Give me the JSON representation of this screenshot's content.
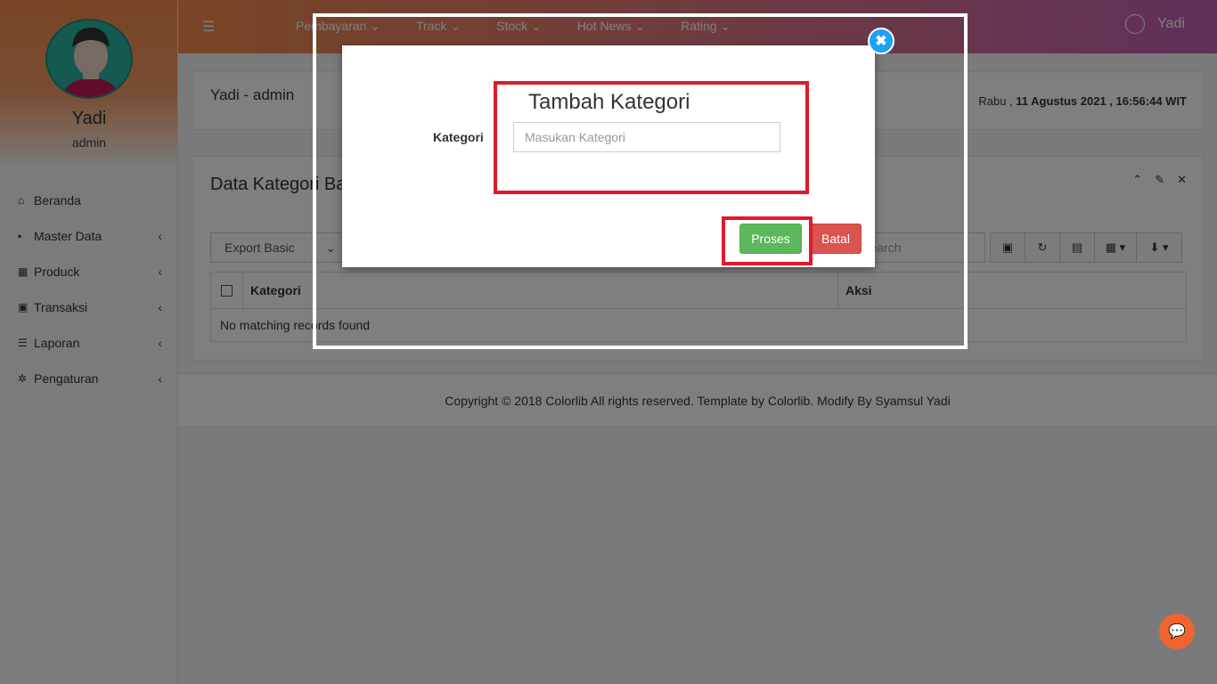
{
  "sidebar": {
    "profile_name": "Yadi",
    "profile_role": "admin",
    "items": [
      {
        "icon": "home-icon",
        "glyph": "⌂",
        "label": "Beranda",
        "has_sub": false
      },
      {
        "icon": "briefcase-icon",
        "glyph": "▪",
        "label": "Master Data",
        "has_sub": true
      },
      {
        "icon": "grid-icon",
        "glyph": "▦",
        "label": "Produck",
        "has_sub": true
      },
      {
        "icon": "money-icon",
        "glyph": "▣",
        "label": "Transaksi",
        "has_sub": true
      },
      {
        "icon": "list-icon",
        "glyph": "☰",
        "label": "Laporan",
        "has_sub": true
      },
      {
        "icon": "gear-icon",
        "glyph": "✲",
        "label": "Pengaturan",
        "has_sub": true
      }
    ]
  },
  "topbar": {
    "nav": [
      "Pembayaran",
      "Track",
      "Stock",
      "Hot News",
      "Rating"
    ],
    "user": "Yadi"
  },
  "header_panel": {
    "title": "Yadi - admin",
    "day": "Rabu",
    "datetime": "11 Agustus 2021 , 16:56:44 WIT"
  },
  "data_panel": {
    "title": "Data Kategori Barang",
    "export_label": "Export Basic",
    "search_placeholder": "Search",
    "columns": [
      "Kategori",
      "Aksi"
    ],
    "empty_text": "No matching records found"
  },
  "footer": {
    "text": "Copyright © 2018 Colorlib All rights reserved. Template by Colorlib. Modify By Syamsul Yadi"
  },
  "modal": {
    "title": "Tambah Kategori",
    "field_label": "Kategori",
    "field_placeholder": "Masukan Kategori",
    "field_value": "",
    "submit_label": "Proses",
    "cancel_label": "Batal"
  },
  "colors": {
    "accent_orange": "#f08a4b",
    "accent_purple": "#c35fb3",
    "success": "#5cb85c",
    "danger": "#d9534f",
    "highlight": "#e0192d",
    "close_blue": "#1da1f2"
  }
}
